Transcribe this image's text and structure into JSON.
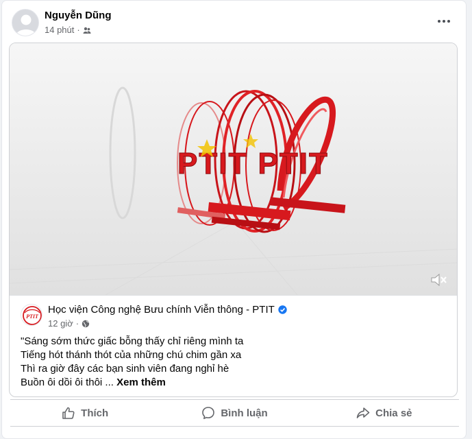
{
  "post": {
    "author": "Nguyễn Dũng",
    "time": "14 phút",
    "audience_icon": "friends-icon",
    "more_icon": "more-options-icon"
  },
  "shared": {
    "page_name": "Học viện Công nghệ Bưu chính Viễn thông - PTIT",
    "verified_icon": "verified-badge-icon",
    "time": "12 giờ",
    "audience_icon": "globe-icon",
    "caption_lines": [
      "\"Sáng sớm thức giấc bỗng thấy chỉ riêng mình ta",
      "Tiếng hót thánh thót của những chú chim gần xa",
      "Thì ra giờ đây các bạn sinh viên đang nghỉ hè",
      "Buồn ôi dồi ôi thôi ..."
    ],
    "see_more": "Xem thêm",
    "logo_text": "PTIT",
    "video_overlay_text": "PTIT PTIT",
    "mute_icon": "muted-speaker-icon"
  },
  "actions": {
    "like": "Thích",
    "comment": "Bình luận",
    "share": "Chia sẻ"
  },
  "colors": {
    "brand_red": "#d7191e",
    "verified_blue": "#1877f2",
    "secondary_text": "#65676b"
  }
}
